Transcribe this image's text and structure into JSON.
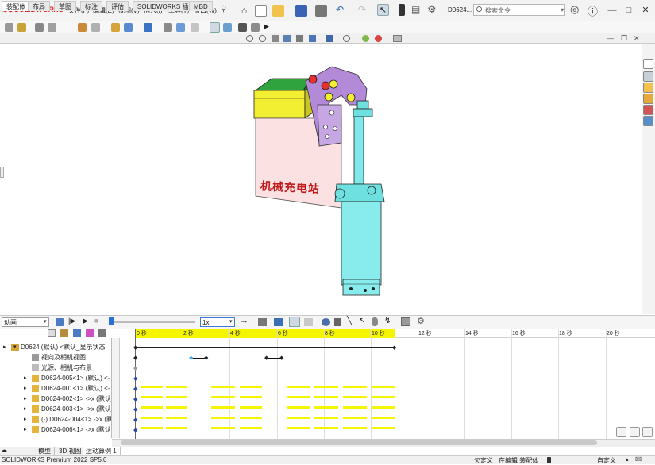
{
  "app": {
    "brand": "SOLIDWORKS",
    "doc_name": "D0624..."
  },
  "menu": [
    "文件(F)",
    "编辑(E)",
    "视图(V)",
    "插入(I)",
    "工具(T)",
    "窗口(W)"
  ],
  "search": {
    "placeholder": "搜索命令"
  },
  "window_controls": {
    "min": "—",
    "max": "□",
    "close": "✕"
  },
  "tabs": [
    "装配体",
    "布局",
    "草图",
    "标注",
    "评估",
    "SOLIDWORKS 插件",
    "MBD"
  ],
  "watermark": "机械充电站",
  "motion": {
    "study_type": "动画",
    "speed": "1x",
    "time_ticks": [
      "0 秒",
      "2 秒",
      "4 秒",
      "6 秒",
      "8 秒",
      "10 秒",
      "12 秒",
      "14 秒",
      "16 秒",
      "18 秒",
      "20 秒"
    ]
  },
  "tree": {
    "rows": [
      "D0624 (默认) <默认_显示状态",
      "视向及相机视图",
      "光源、相机与布景",
      "D0624-005<1> (默认) <-",
      "D0624-001<1> (默认) <-",
      "D0624-002<1> ->x (默认",
      "D0624-003<1> ->x (默认",
      "(-) D0624-004<1> ->x (默",
      "D0624-006<1> ->x (默认"
    ]
  },
  "bottom_tabs": [
    "模型",
    "3D 视图",
    "运动算例 1"
  ],
  "status": {
    "product": "SOLIDWORKS Premium 2022 SP5.0",
    "underdefined": "欠定义",
    "editing": "在编辑 装配体",
    "custom": "自定义"
  },
  "colors": {
    "accent": "#2a6fd8",
    "timeline_highlight": "#f5f500",
    "brand": "#dd2222"
  }
}
